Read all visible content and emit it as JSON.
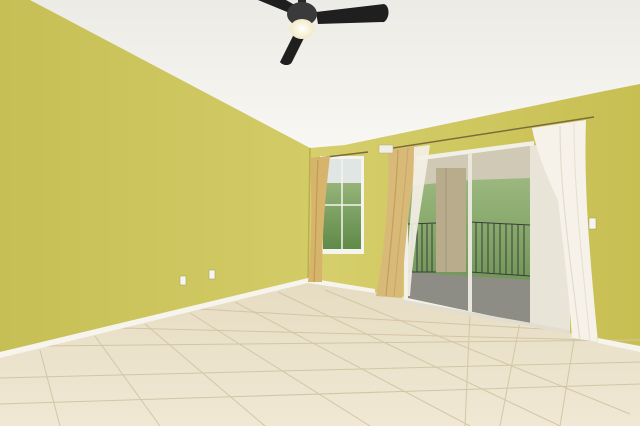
{
  "scene": {
    "subject": "empty room",
    "colors": {
      "ceiling": "#f3f1ec",
      "left_wall": "#c9c259",
      "right_wall": "#cfc75e",
      "floor_tile": "#ece3cc",
      "grout": "#d9ceb0",
      "baseboard": "#f4f2ea",
      "curtain_sheer": "#f5f1e8",
      "curtain_gold": "#d9b978",
      "fan_body": "#2a2a2a",
      "fan_light": "#fffbe8",
      "greenery": "#7fa05e",
      "balcony_floor": "#8d8d86",
      "railing": "#3c3c3c"
    }
  }
}
